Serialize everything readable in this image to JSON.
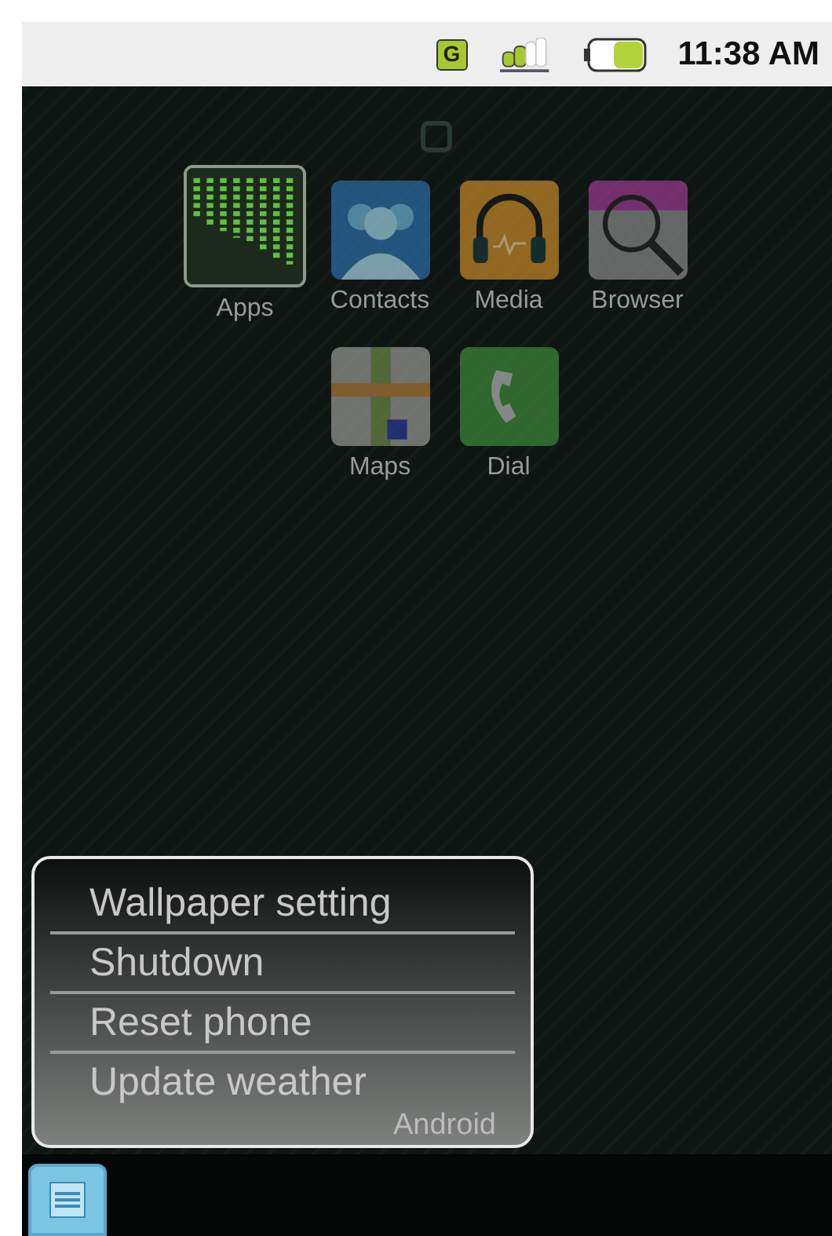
{
  "status_bar": {
    "network": "G",
    "time": "11:38 AM"
  },
  "home_rows": [
    [
      {
        "kind": "apps",
        "label": "Apps",
        "selected": true
      },
      {
        "kind": "contacts",
        "label": "Contacts",
        "selected": false
      },
      {
        "kind": "media",
        "label": "Media",
        "selected": false
      },
      {
        "kind": "browser",
        "label": "Browser",
        "selected": false
      }
    ],
    [
      {
        "kind": "maps",
        "label": "Maps",
        "selected": false
      },
      {
        "kind": "dial",
        "label": "Dial",
        "selected": false
      }
    ]
  ],
  "menu": {
    "items": [
      "Wallpaper setting",
      "Shutdown",
      "Reset phone",
      "Update weather"
    ],
    "footer": "Android"
  }
}
